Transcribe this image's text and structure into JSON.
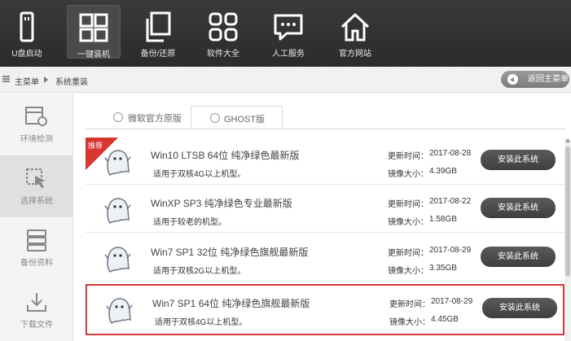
{
  "toolbar": {
    "items": [
      {
        "label": "U盘启动",
        "icon": "usb-drive-icon"
      },
      {
        "label": "一键装机",
        "icon": "windows-logo-icon",
        "active": true
      },
      {
        "label": "备份/还原",
        "icon": "copy-documents-icon"
      },
      {
        "label": "软件大全",
        "icon": "apps-grid-icon"
      },
      {
        "label": "人工服务",
        "icon": "chat-bubble-icon"
      },
      {
        "label": "官方网站",
        "icon": "home-icon"
      }
    ]
  },
  "breadcrumb": {
    "home": "主菜单",
    "current": "系统重装",
    "back_label": "返回主菜单"
  },
  "sidebar": {
    "items": [
      {
        "label": "环境检测",
        "icon": "hardware-check-icon"
      },
      {
        "label": "选择系统",
        "icon": "cursor-select-icon",
        "active": true
      },
      {
        "label": "备份资料",
        "icon": "database-icon"
      },
      {
        "label": "下载文件",
        "icon": "download-icon"
      }
    ]
  },
  "tabs": [
    {
      "label": "微软官方原版",
      "active": false
    },
    {
      "label": "GHOST版",
      "active": true
    }
  ],
  "labels": {
    "update_time": "更新时间：",
    "image_size": "镜像大小：",
    "badge": "推荐"
  },
  "systems": [
    {
      "title": "Win10 LTSB 64位 纯净绿色最新版",
      "desc": "适用于双核4G以上机型。",
      "date": "2017-08-28",
      "size": "4.39GB",
      "button": "安装此系统",
      "recommended": true
    },
    {
      "title": "WinXP SP3 纯净绿色专业最新版",
      "desc": "适用于较老的机型。",
      "date": "2017-08-22",
      "size": "1.58GB",
      "button": "安装此系统"
    },
    {
      "title": "Win7 SP1 32位 纯净绿色旗舰最新版",
      "desc": "适用于双核2G以上机型。",
      "date": "2017-08-29",
      "size": "3.35GB",
      "button": "安装此系统"
    },
    {
      "title": "Win7 SP1 64位 纯净绿色旗舰最新版",
      "desc": "适用于双核4G以上机型。",
      "date": "2017-08-29",
      "size": "4.45GB",
      "button": "安装此系统",
      "selected": true
    }
  ],
  "colors": {
    "selection_border": "#d23a3a",
    "badge": "#d8352f",
    "toolbar_bg": "#2e2e2e"
  }
}
